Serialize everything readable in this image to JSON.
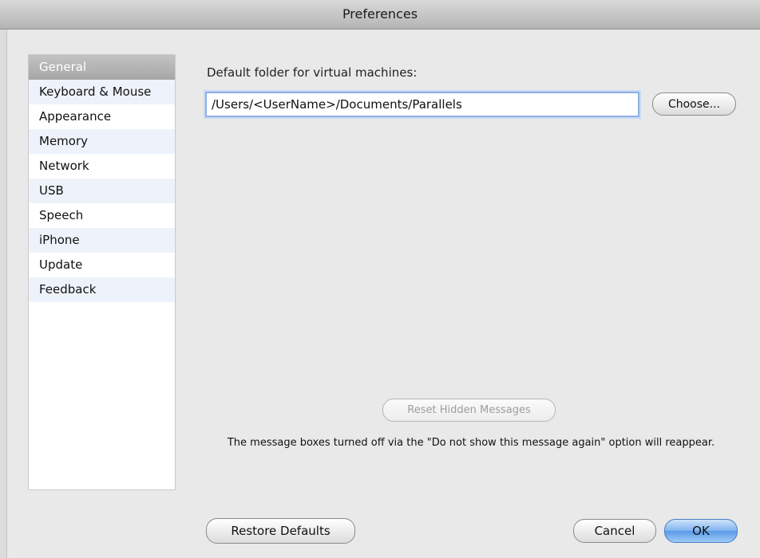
{
  "window": {
    "title": "Preferences"
  },
  "sidebar": {
    "items": [
      {
        "label": "General",
        "selected": true
      },
      {
        "label": "Keyboard & Mouse"
      },
      {
        "label": "Appearance"
      },
      {
        "label": "Memory"
      },
      {
        "label": "Network"
      },
      {
        "label": "USB"
      },
      {
        "label": "Speech"
      },
      {
        "label": "iPhone"
      },
      {
        "label": "Update"
      },
      {
        "label": "Feedback"
      }
    ]
  },
  "general": {
    "folder_label": "Default folder for virtual machines:",
    "folder_path": "/Users/<UserName>/Documents/Parallels",
    "choose_label": "Choose...",
    "reset_label": "Reset Hidden Messages",
    "reset_note": "The message boxes turned off via the \"Do not show this message again\" option will reappear."
  },
  "footer": {
    "restore_label": "Restore Defaults",
    "cancel_label": "Cancel",
    "ok_label": "OK"
  },
  "colors": {
    "selection": "#b0b0b0",
    "field_focus": "#8fb1e3",
    "default_button": "#6aa7ee"
  }
}
